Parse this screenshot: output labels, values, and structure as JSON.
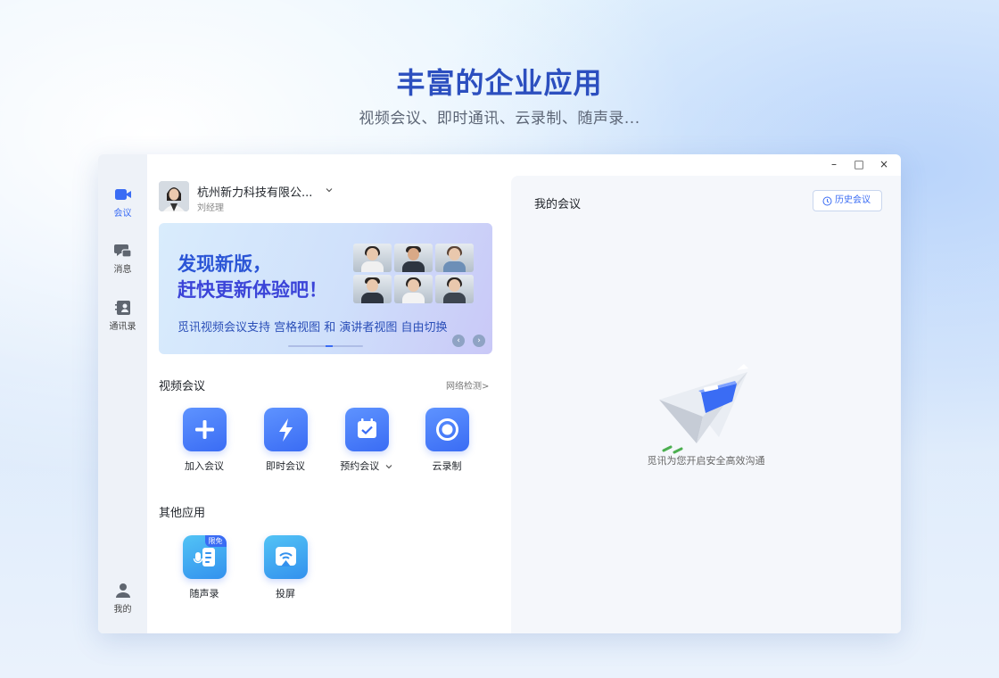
{
  "hero": {
    "title": "丰富的企业应用",
    "subtitle": "视频会议、即时通讯、云录制、随声录..."
  },
  "window_controls": {
    "minimize": "–",
    "maximize": "□",
    "close": "×"
  },
  "sidebar": {
    "items": [
      {
        "label": "会议",
        "icon": "video-camera-icon",
        "active": true
      },
      {
        "label": "消息",
        "icon": "chat-icon",
        "active": false
      },
      {
        "label": "通讯录",
        "icon": "contacts-icon",
        "active": false
      },
      {
        "label": "我的",
        "icon": "user-icon",
        "active": false
      }
    ]
  },
  "user": {
    "org": "杭州新力科技有限公...",
    "role": "刘经理"
  },
  "banner": {
    "headline_line1": "发现新版，",
    "headline_line2": "赶快更新体验吧！",
    "description": "觅讯视频会议支持 宫格视图 和 演讲者视图 自由切换",
    "prev": "‹",
    "next": "›"
  },
  "video_meeting": {
    "title": "视频会议",
    "network_check": "网络检测>",
    "apps": [
      {
        "label": "加入会议",
        "icon": "plus-icon"
      },
      {
        "label": "即时会议",
        "icon": "lightning-icon"
      },
      {
        "label": "预约会议",
        "icon": "calendar-check-icon",
        "has_dropdown": true
      },
      {
        "label": "云录制",
        "icon": "record-icon"
      }
    ]
  },
  "other_apps": {
    "title": "其他应用",
    "apps": [
      {
        "label": "随声录",
        "icon": "voice-note-icon",
        "badge": "限免"
      },
      {
        "label": "投屏",
        "icon": "screen-cast-icon"
      }
    ]
  },
  "my_meetings": {
    "title": "我的会议",
    "history_button": "历史会议",
    "empty_text": "觅讯为您开启安全高效沟通"
  },
  "colors": {
    "accent": "#3a6cf4",
    "hero_title": "#2c4fbf",
    "sidebar_bg": "#eef2f8",
    "right_pane_bg": "#f5f7fb"
  }
}
